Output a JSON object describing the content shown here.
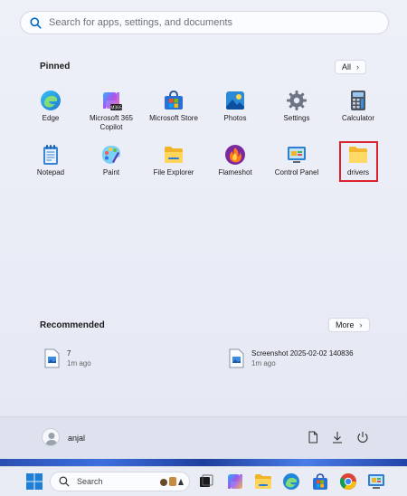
{
  "search": {
    "placeholder": "Search for apps, settings, and documents"
  },
  "pinned": {
    "title": "Pinned",
    "all_label": "All",
    "apps": [
      {
        "label": "Edge",
        "icon": "edge-icon"
      },
      {
        "label": "Microsoft 365 Copilot",
        "icon": "m365-copilot-icon"
      },
      {
        "label": "Microsoft Store",
        "icon": "store-icon"
      },
      {
        "label": "Photos",
        "icon": "photos-icon"
      },
      {
        "label": "Settings",
        "icon": "gear-icon"
      },
      {
        "label": "Calculator",
        "icon": "calculator-icon"
      },
      {
        "label": "Notepad",
        "icon": "notepad-icon"
      },
      {
        "label": "Paint",
        "icon": "paint-icon"
      },
      {
        "label": "File Explorer",
        "icon": "folder-icon"
      },
      {
        "label": "Flameshot",
        "icon": "flameshot-icon"
      },
      {
        "label": "Control Panel",
        "icon": "control-panel-icon"
      },
      {
        "label": "drivers",
        "icon": "folder-icon"
      }
    ],
    "m365_badge": "M365"
  },
  "recommended": {
    "title": "Recommended",
    "more_label": "More",
    "items": [
      {
        "name": "7",
        "time": "1m ago"
      },
      {
        "name": "Screenshot 2025-02-02 140836",
        "time": "1m ago"
      }
    ]
  },
  "user": {
    "name": "anjal"
  },
  "taskbar": {
    "search_label": "Search"
  },
  "colors": {
    "highlight": "#d9232d",
    "accent": "#0067c0"
  }
}
